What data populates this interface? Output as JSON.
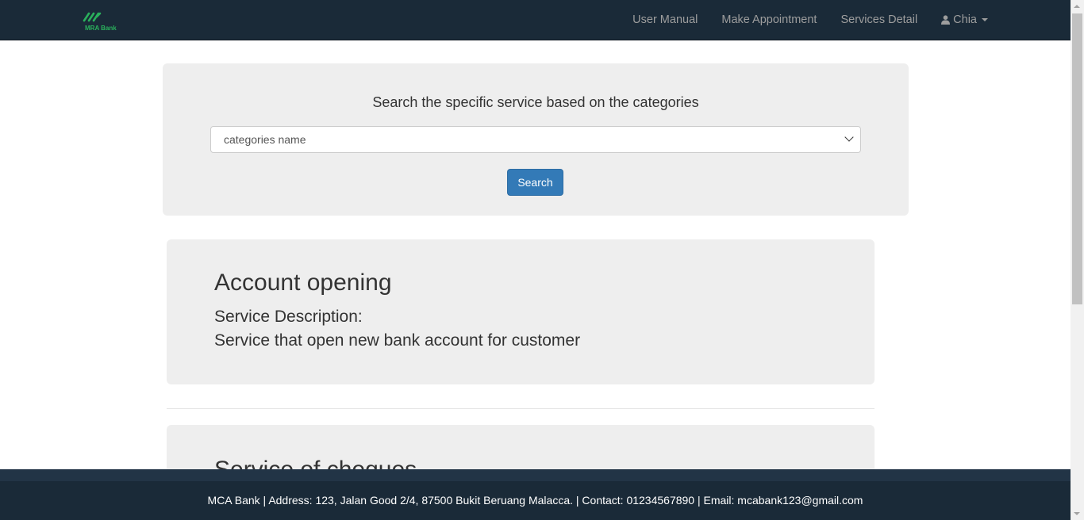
{
  "navbar": {
    "logo_text": "MRA Bank",
    "links": [
      "User Manual",
      "Make Appointment",
      "Services Detail"
    ],
    "user_name": "Chia"
  },
  "search": {
    "heading": "Search the specific service based on the categories",
    "select_value": "categories name",
    "button_label": "Search"
  },
  "services": [
    {
      "title": "Account opening",
      "description_label": "Service Description:",
      "description": "Service that open new bank account for customer"
    },
    {
      "title": "Service of cheques"
    }
  ],
  "footer": {
    "text": "MCA Bank | Address: 123, Jalan Good 2/4, 87500 Bukit Beruang Malacca. | Contact: 01234567890 | Email: mcabank123@gmail.com"
  },
  "colors": {
    "navbar_bg": "#1a2a38",
    "primary_button": "#337ab7",
    "panel_bg": "#eeeeee",
    "logo_green": "#2ab05c"
  }
}
